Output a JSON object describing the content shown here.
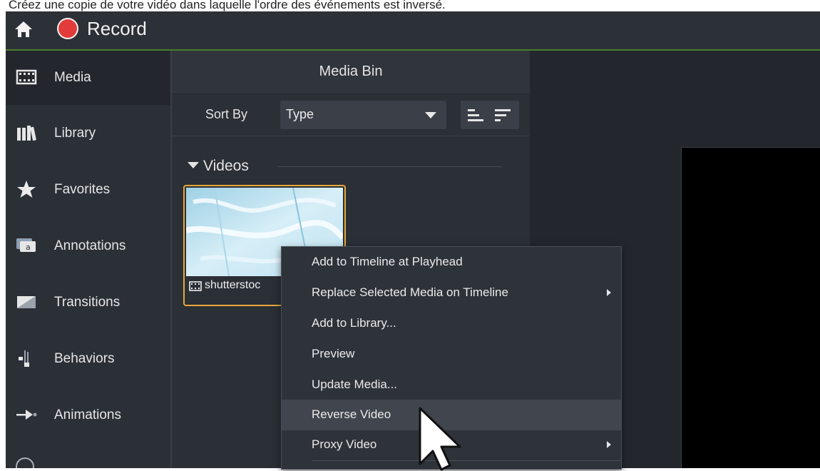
{
  "caption": "Créez une copie de votre vidéo dans laquelle l'ordre des événements est inversé.",
  "topbar": {
    "record_label": "Record"
  },
  "sidebar": {
    "items": [
      {
        "label": "Media",
        "icon": "film-strip-icon",
        "active": true
      },
      {
        "label": "Library",
        "icon": "books-icon"
      },
      {
        "label": "Favorites",
        "icon": "star-icon"
      },
      {
        "label": "Annotations",
        "icon": "speech-bubble-icon"
      },
      {
        "label": "Transitions",
        "icon": "transition-icon"
      },
      {
        "label": "Behaviors",
        "icon": "behaviors-icon"
      },
      {
        "label": "Animations",
        "icon": "arrow-icon"
      }
    ]
  },
  "media_bin": {
    "title": "Media Bin",
    "sort_label": "Sort By",
    "sort_value": "Type",
    "group": "Videos",
    "clip_name": "shutterstoc"
  },
  "context_menu": {
    "items": [
      {
        "label": "Add to Timeline at Playhead"
      },
      {
        "label": "Replace Selected Media on Timeline",
        "submenu": true
      },
      {
        "label": "Add to Library..."
      },
      {
        "label": "Preview"
      },
      {
        "label": "Update Media..."
      },
      {
        "label": "Reverse Video",
        "highlighted": true
      },
      {
        "label": "Proxy Video",
        "submenu": true
      }
    ]
  },
  "colors": {
    "accent_green": "#4a7c2c",
    "record_red": "#e33b3b",
    "selection_orange": "#e6a93a",
    "panel_bg": "#2b2f36"
  }
}
